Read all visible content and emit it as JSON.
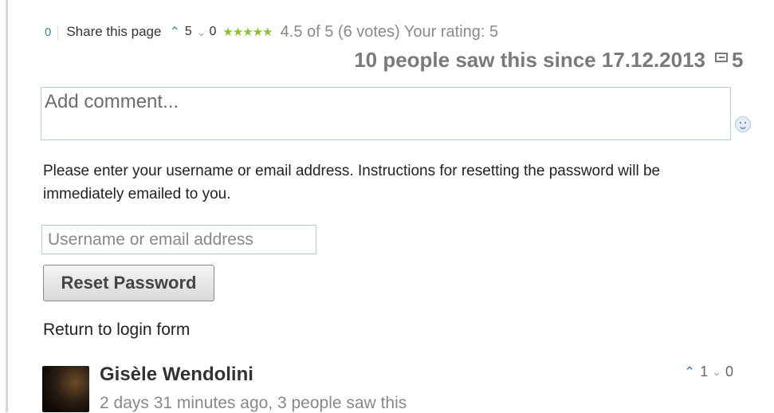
{
  "share": {
    "count": "0",
    "label": "Share this page",
    "up_votes": "5",
    "down_votes": "0",
    "stars": "★★★★★",
    "rating_text": "4.5 of 5 (6 votes) Your rating: 5"
  },
  "stats": {
    "views_text": "10 people saw this since 17.12.2013",
    "comment_count": "5"
  },
  "comment_form": {
    "placeholder": "Add comment..."
  },
  "reset": {
    "instructions": "Please enter your username or email address. Instructions for resetting the password will be immediately emailed to you.",
    "username_placeholder": "Username or email address",
    "button_label": "Reset Password",
    "return_label": "Return to login form"
  },
  "comment": {
    "author": "Gisèle Wendolini",
    "meta": "2 days 31 minutes ago, 3 people saw this",
    "up_votes": "1",
    "down_votes": "0"
  },
  "colors": {
    "accent": "#3a7fc1",
    "stars": "#8fc232",
    "muted": "#7a7a7a"
  }
}
